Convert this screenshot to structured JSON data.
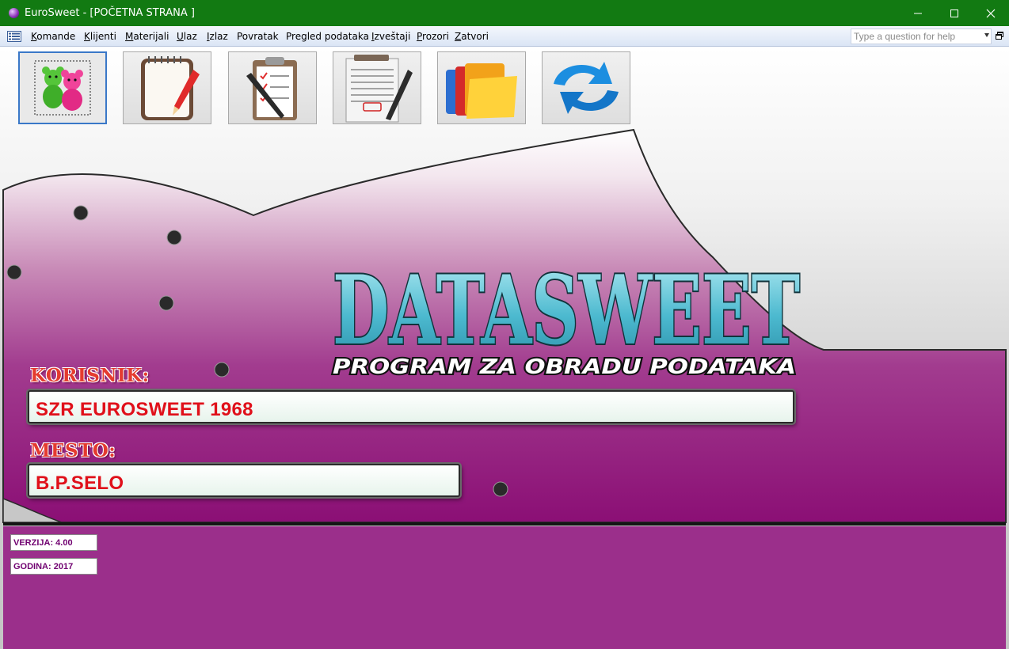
{
  "window": {
    "title": "EuroSweet - [POČETNA STRANA ]"
  },
  "menu": {
    "items": [
      {
        "label": "Komande",
        "accel": "K",
        "rest": "omande"
      },
      {
        "label": "Klijenti",
        "accel": "K",
        "rest": "lijenti"
      },
      {
        "label": "Materijali",
        "accel": "M",
        "rest": "aterijali"
      },
      {
        "label": "Ulaz",
        "accel": "U",
        "rest": "laz"
      },
      {
        "label": "Izlaz",
        "accel": "I",
        "rest": "zlaz"
      },
      {
        "label": "Povratak",
        "accel": "",
        "rest": "Povratak"
      },
      {
        "label": "Pregled podataka",
        "accel": "",
        "rest": "Pregled podataka"
      },
      {
        "label": "Izveštaji",
        "accel": "I",
        "rest": "zveštaji"
      },
      {
        "label": "Prozori",
        "accel": "P",
        "rest": "rozori"
      },
      {
        "label": "Zatvori",
        "accel": "Z",
        "rest": "atvori"
      }
    ],
    "help_placeholder": "Type a question for help"
  },
  "toolbar": {
    "buttons": [
      {
        "name": "klijenti-button",
        "icon": "teddy-bears-icon"
      },
      {
        "name": "notes-button",
        "icon": "notepad-pencil-icon"
      },
      {
        "name": "checklist-button",
        "icon": "clipboard-checklist-icon"
      },
      {
        "name": "invoice-button",
        "icon": "paid-invoice-pen-icon"
      },
      {
        "name": "folders-button",
        "icon": "folders-icon"
      },
      {
        "name": "refresh-button",
        "icon": "refresh-arrows-icon"
      }
    ]
  },
  "logo": {
    "title": "DATASWEET",
    "subtitle": "PROGRAM ZA OBRADU PODATAKA"
  },
  "user": {
    "korisnik_label": "KORISNIK:",
    "korisnik_value": "SZR EUROSWEET 1968",
    "mesto_label": "MESTO:",
    "mesto_value": "B.P.SELO"
  },
  "info": {
    "verzija": "VERZIJA: 4.00",
    "godina": "GODINA: 2017"
  },
  "colors": {
    "titlebar": "#127a12",
    "purple": "#8d1a7a",
    "label_red": "#e43b2f",
    "field_text": "#e0101a",
    "logo_cyan": "#5fc6d8"
  }
}
